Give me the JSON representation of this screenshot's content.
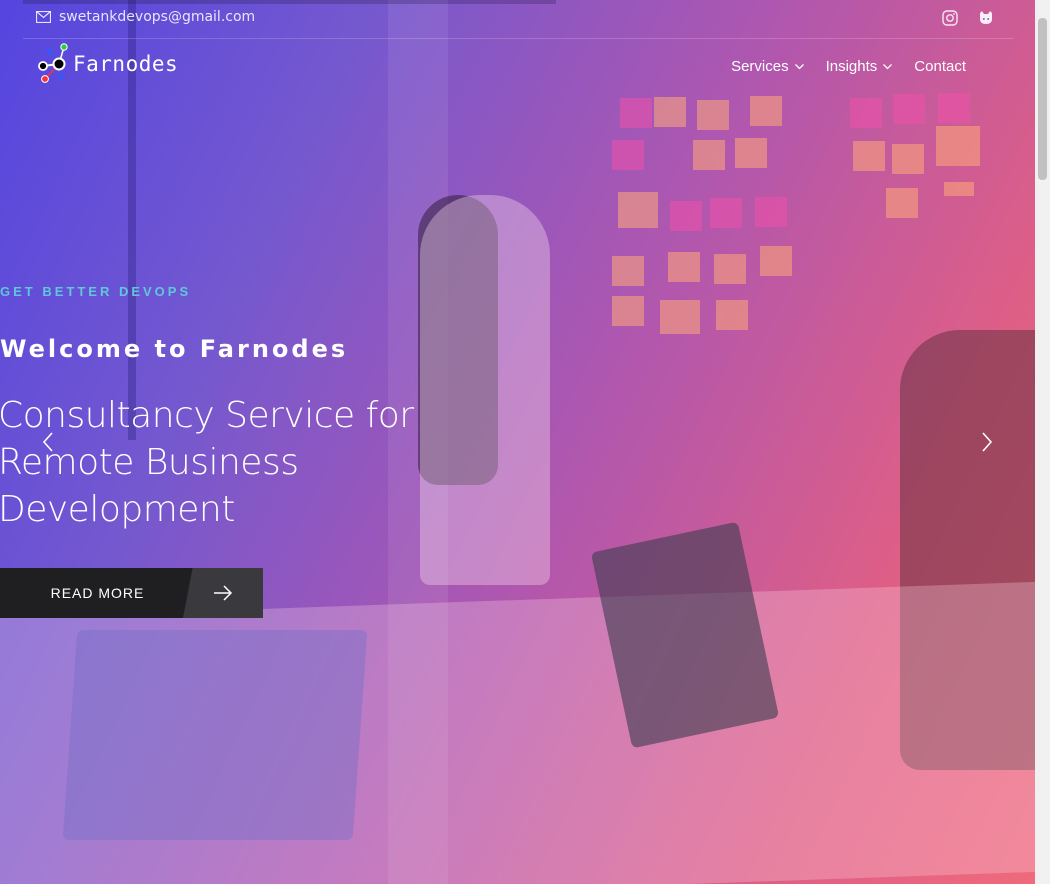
{
  "topbar": {
    "email": "swetankdevops@gmail.com",
    "social_icons": [
      "instagram-icon",
      "github-icon"
    ]
  },
  "header": {
    "brand": "Farnodes",
    "nav": [
      {
        "label": "Services",
        "has_dropdown": true
      },
      {
        "label": "Insights",
        "has_dropdown": true
      },
      {
        "label": "Contact",
        "has_dropdown": false
      }
    ]
  },
  "hero": {
    "kicker": "GET BETTER DEVOPS",
    "welcome": "Welcome to Farnodes",
    "headline": "Consultancy Service for Remote Business Development",
    "cta_label": "READ MORE"
  },
  "colors": {
    "kicker": "#5fc8d8",
    "button": "#1f1f22",
    "overlay_start": "#5446e2",
    "overlay_end": "#f66c78"
  }
}
